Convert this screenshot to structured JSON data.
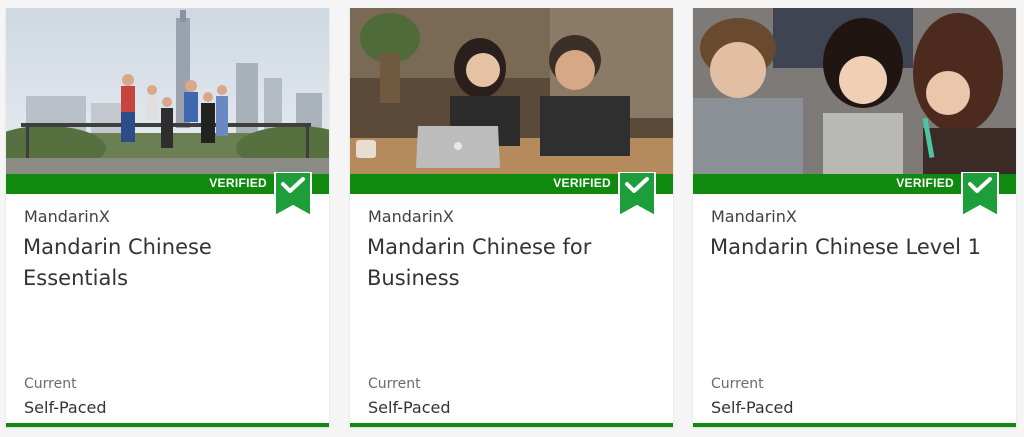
{
  "colors": {
    "accent_green": "#0f8a0f",
    "ribbon_green": "#1e9e3a"
  },
  "cards": [
    {
      "image": "group-jumping-rooftop-city-photo",
      "badge": "VERIFIED",
      "badge_icon": "verified-ribbon-checkmark-icon",
      "org": "MandarinX",
      "title": "Mandarin Chinese Essentials",
      "status_label": "Current",
      "pace": "Self-Paced"
    },
    {
      "image": "two-people-laptop-cafe-photo",
      "badge": "VERIFIED",
      "badge_icon": "verified-ribbon-checkmark-icon",
      "org": "MandarinX",
      "title": "Mandarin Chinese for Business",
      "status_label": "Current",
      "pace": "Self-Paced"
    },
    {
      "image": "students-studying-classroom-photo",
      "badge": "VERIFIED",
      "badge_icon": "verified-ribbon-checkmark-icon",
      "org": "MandarinX",
      "title": "Mandarin Chinese Level 1",
      "status_label": "Current",
      "pace": "Self-Paced"
    }
  ]
}
